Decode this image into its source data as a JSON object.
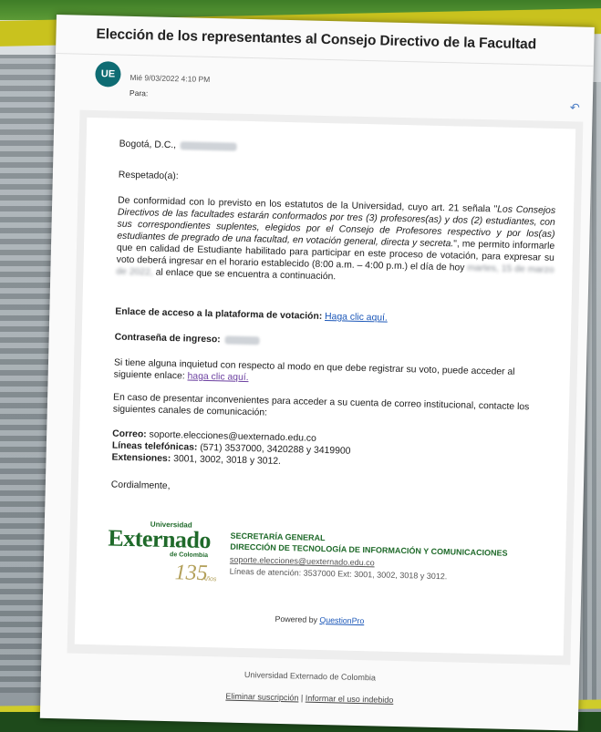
{
  "email": {
    "subject": "Elección de los representantes al Consejo Directivo de la Facultad",
    "sender_initials": "UE",
    "date": "Mié 9/03/2022 4:10 PM",
    "to_label": "Para:"
  },
  "letter": {
    "city_line": "Bogotá, D.C.,",
    "greeting": "Respetado(a):",
    "para1_a": "De conformidad con lo previsto en los estatutos de la Universidad, cuyo art. 21 señala \"",
    "para1_quote": "Los Consejos Directivos de las facultades estarán conformados por tres (3) profesores(as) y dos (2) estudiantes, con sus correspondientes suplentes, elegidos por el Consejo de Profesores respectivo y por los(as) estudiantes de pregrado de una facultad, en votación general, directa y secreta.",
    "para1_b": "\", me permito informarle que en calidad de Estudiante habilitado para participar en este proceso de votación, para expresar su voto deberá ingresar en el horario establecido (8:00 a.m. – 4:00 p.m.) el día de hoy",
    "para1_blurred": "martes, 15 de marzo de 2022,",
    "para1_c": "al enlace que se encuentra a continuación.",
    "access_label": "Enlace de acceso a la plataforma de votación:",
    "access_link": "Haga clic aquí.",
    "password_label": "Contraseña de ingreso:",
    "help_text": "Si tiene alguna inquietud con respecto al modo en que debe registrar su voto, puede acceder al siguiente enlace:",
    "help_link": "haga clic aquí.",
    "problems_text": "En caso de presentar inconvenientes para acceder a su cuenta de correo institucional, contacte los siguientes canales de comunicación:",
    "mail_label": "Correo:",
    "mail_value": "soporte.elecciones@uexternado.edu.co",
    "phones_label": "Líneas telefónicas:",
    "phones_value": "(571) 3537000, 3420288 y 3419900",
    "ext_label": "Extensiones:",
    "ext_value": "3001, 3002, 3018 y 3012.",
    "closing": "Cordialmente,"
  },
  "logo": {
    "university_small": "Universidad",
    "name": "Externado",
    "de_colombia": "de Colombia",
    "anniversary": "135",
    "anos": "Años"
  },
  "signature": {
    "line1": "SECRETARÍA GENERAL",
    "line2": "DIRECCIÓN DE TECNOLOGÍA DE INFORMACIÓN Y COMUNICACIONES",
    "line3": "soporte.elecciones@uexternado.edu.co",
    "line4": "Líneas de atención: 3537000 Ext: 3001, 3002, 3018 y 3012."
  },
  "powered": {
    "prefix": "Powered by",
    "brand": "QuestionPro"
  },
  "footer": {
    "org": "Universidad Externado de Colombia",
    "unsubscribe": "Eliminar suscripción",
    "separator": "|",
    "report": "Informar el uso indebido"
  },
  "colors": {
    "avatar": "#0f6c73",
    "link": "#1a56b8",
    "brand_green": "#1f6a2a"
  }
}
